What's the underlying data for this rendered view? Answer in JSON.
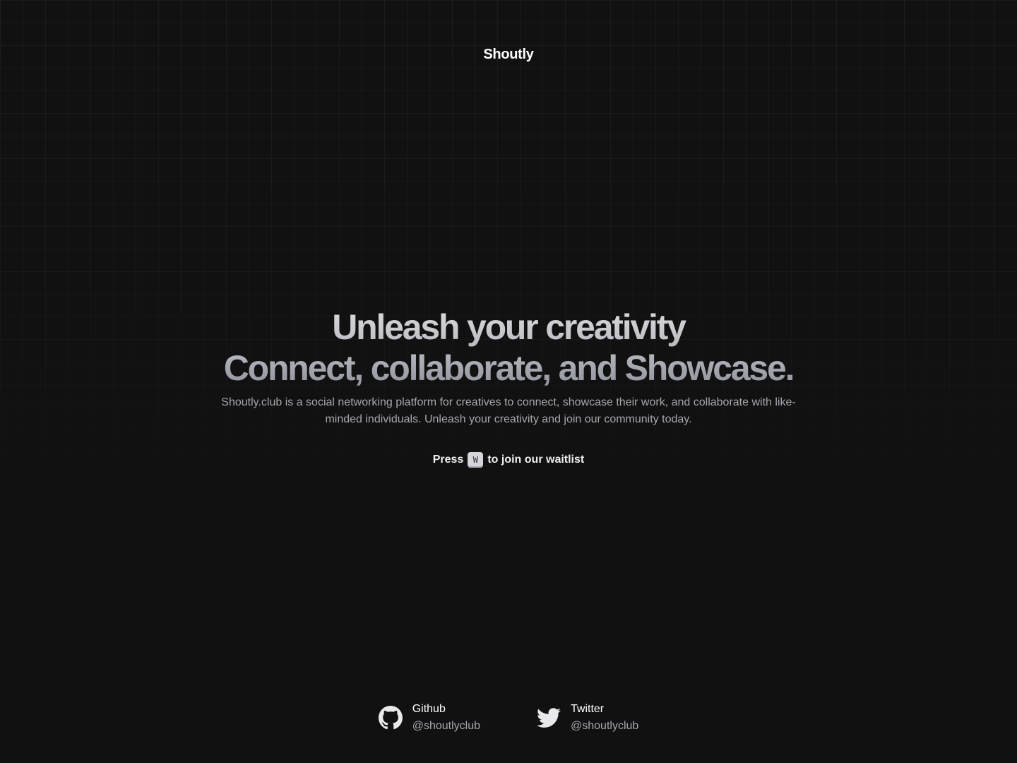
{
  "header": {
    "brand": "Shoutly"
  },
  "hero": {
    "headline_line1": "Unleash your creativity",
    "headline_line2": "Connect, collaborate, and Showcase.",
    "description": "Shoutly.club is a social networking platform for creatives to connect, showcase their work, and collaborate with like-minded individuals. Unleash your creativity and join our community today.",
    "cta_prefix": "Press",
    "cta_key": "W",
    "cta_suffix": "to join our waitlist"
  },
  "footer": {
    "links": [
      {
        "name": "Github",
        "handle": "@shoutlyclub",
        "icon": "github-icon"
      },
      {
        "name": "Twitter",
        "handle": "@shoutlyclub",
        "icon": "twitter-icon"
      }
    ]
  },
  "colors": {
    "background": "#111111",
    "text_primary": "#ffffff",
    "text_muted": "#a4a7ae",
    "kbd_bg": "#d4d6db"
  }
}
